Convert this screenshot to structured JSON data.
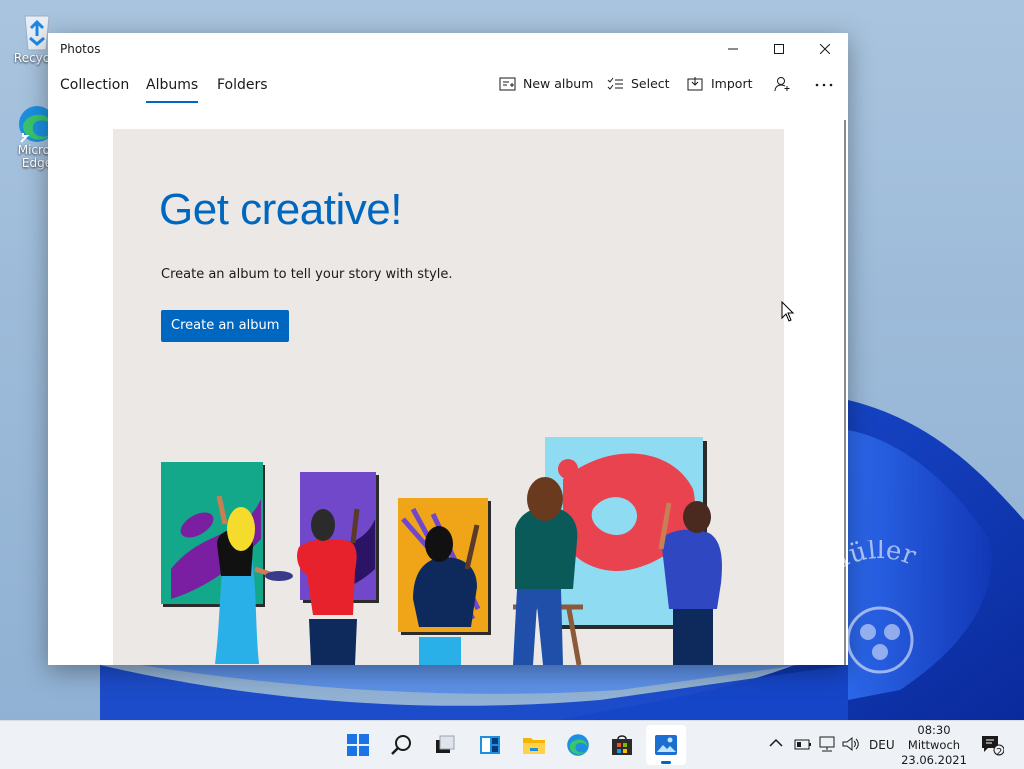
{
  "desktop": {
    "icons": [
      {
        "label": "Recycle",
        "icon": "recycle-bin-icon"
      },
      {
        "label": "Micros\nEdge",
        "icon": "edge-icon"
      }
    ],
    "watermark_text": "Lars Müller"
  },
  "window": {
    "title": "Photos",
    "caption_buttons": {
      "minimize": "minimize-icon",
      "maximize": "maximize-icon",
      "close": "close-icon"
    }
  },
  "nav": {
    "tabs": [
      {
        "label": "Collection",
        "active": false
      },
      {
        "label": "Albums",
        "active": true
      },
      {
        "label": "Folders",
        "active": false
      }
    ],
    "commands": {
      "new_album": "New album",
      "select": "Select",
      "import": "Import"
    }
  },
  "hero": {
    "heading": "Get creative!",
    "subtitle": "Create an album to tell your story with style.",
    "cta_label": "Create an album"
  },
  "taskbar": {
    "apps": [
      "start-icon",
      "search-icon",
      "task-view-icon",
      "widgets-icon",
      "file-explorer-icon",
      "edge-icon",
      "store-icon",
      "photos-icon"
    ],
    "active_app": "photos-icon",
    "language": "DEU",
    "time": "08:30",
    "day": "Mittwoch",
    "date": "23.06.2021",
    "notifications": "2"
  },
  "colors": {
    "accent": "#0067c0",
    "hero_bg": "#ece8e5",
    "taskbar_bg": "#eef1f6"
  }
}
